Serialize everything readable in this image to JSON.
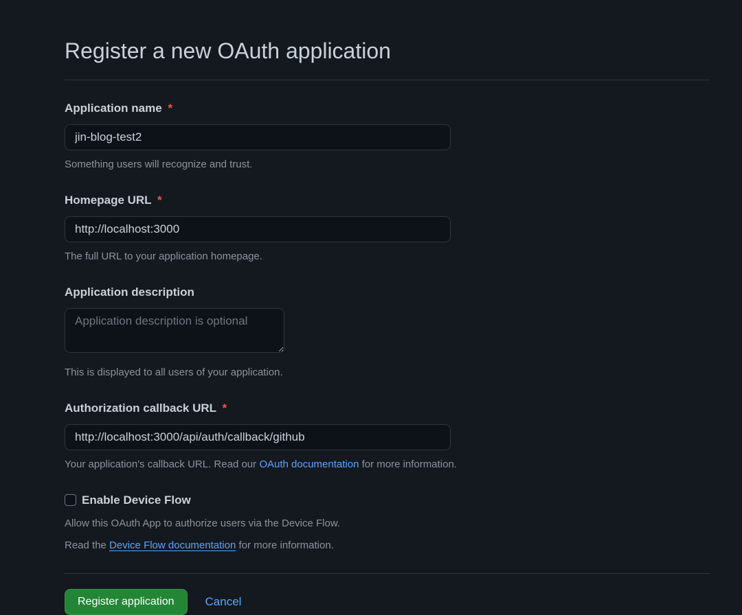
{
  "page": {
    "title": "Register a new OAuth application"
  },
  "fields": {
    "app_name": {
      "label": "Application name",
      "value": "jin-blog-test2",
      "help": "Something users will recognize and trust.",
      "required": true
    },
    "homepage_url": {
      "label": "Homepage URL",
      "value": "http://localhost:3000",
      "help": "The full URL to your application homepage.",
      "required": true
    },
    "app_description": {
      "label": "Application description",
      "value": "",
      "placeholder": "Application description is optional",
      "help": "This is displayed to all users of your application.",
      "required": false
    },
    "callback_url": {
      "label": "Authorization callback URL",
      "value": "http://localhost:3000/api/auth/callback/github",
      "help_prefix": "Your application's callback URL. Read our ",
      "help_link_text": "OAuth documentation",
      "help_suffix": " for more information.",
      "required": true
    },
    "device_flow": {
      "label": "Enable Device Flow",
      "checked": false,
      "help_line1": "Allow this OAuth App to authorize users via the Device Flow.",
      "help_prefix": "Read the ",
      "help_link_text": "Device Flow documentation",
      "help_suffix": " for more information."
    }
  },
  "buttons": {
    "submit": "Register application",
    "cancel": "Cancel"
  }
}
